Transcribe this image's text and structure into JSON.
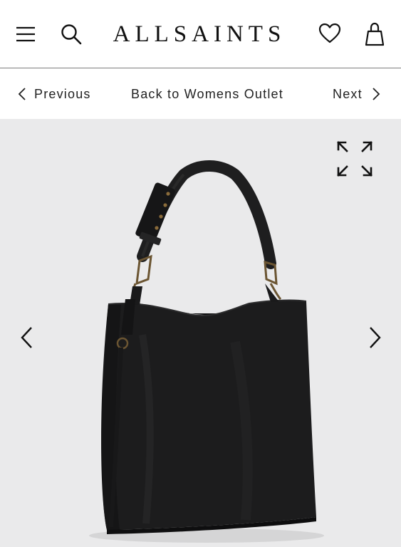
{
  "header": {
    "brand": "ALLSAINTS",
    "icons": [
      "menu-icon",
      "search-icon",
      "heart-icon",
      "bag-icon"
    ]
  },
  "nav": {
    "previous_label": "Previous",
    "back_label": "Back to Womens Outlet",
    "next_label": "Next"
  },
  "gallery": {
    "icons": [
      "expand-icon",
      "chevron-left-icon",
      "chevron-right-icon"
    ],
    "background": "#eaeaeb"
  },
  "colors": {
    "text": "#111111",
    "divider": "#7a7a7a",
    "bag": "#1b1b1c"
  }
}
